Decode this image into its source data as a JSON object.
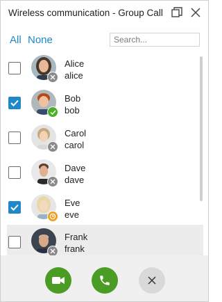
{
  "window": {
    "title": "Wireless communication - Group Call"
  },
  "filters": {
    "all_label": "All",
    "none_label": "None"
  },
  "search": {
    "placeholder": "Search...",
    "value": ""
  },
  "contacts": [
    {
      "name": "Alice",
      "username": "alice",
      "checked": false,
      "status": "offline",
      "hover": false
    },
    {
      "name": "Bob",
      "username": "bob",
      "checked": true,
      "status": "online",
      "hover": false
    },
    {
      "name": "Carol",
      "username": "carol",
      "checked": false,
      "status": "offline",
      "hover": false
    },
    {
      "name": "Dave",
      "username": "dave",
      "checked": false,
      "status": "offline",
      "hover": false
    },
    {
      "name": "Eve",
      "username": "eve",
      "checked": true,
      "status": "away",
      "hover": false
    },
    {
      "name": "Frank",
      "username": "frank",
      "checked": false,
      "status": "offline",
      "hover": true
    }
  ],
  "actions": {
    "video_icon": "video-camera-icon",
    "audio_icon": "phone-icon",
    "cancel_icon": "close-icon"
  },
  "colors": {
    "accent": "#1e88c9",
    "call_green": "#4a9c24",
    "online": "#4caf28",
    "away": "#f0a020",
    "offline": "#8a8a8a"
  }
}
